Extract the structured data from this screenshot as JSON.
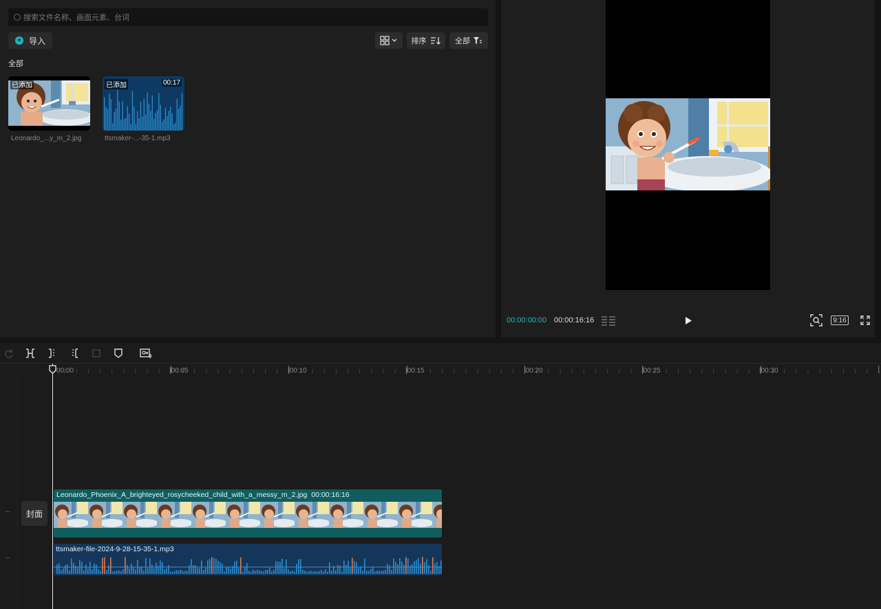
{
  "media": {
    "search_placeholder": "搜索文件名称、画面元素、台词",
    "import_label": "导入",
    "sort_label": "排序",
    "filter_label": "全部",
    "section_label": "全部",
    "items": [
      {
        "name": "Leonardo_...y_m_2.jpg",
        "badge": "已添加",
        "duration": ""
      },
      {
        "name": "ttsmaker-...-35-1.mp3",
        "badge": "已添加",
        "duration": "00:17"
      }
    ]
  },
  "preview": {
    "current_time": "00:00:00:00",
    "total_time": "00:00:16:16",
    "ratio_label": "9:16"
  },
  "timeline": {
    "ruler_labels": [
      "00:00",
      "|00:05",
      "|00:10",
      "|00:15",
      "|00:20",
      "|00:25",
      "|00:30"
    ],
    "cover_label": "封面",
    "video_clip": {
      "name": "Leonardo_Phoenix_A_brighteyed_rosycheeked_child_with_a_messy_m_2.jpg",
      "duration": "00:00:16:16"
    },
    "audio_clip": {
      "name": "ttsmaker-file-2024-9-28-15-35-1.mp3"
    },
    "more_label": "···"
  },
  "colors": {
    "accent": "#1fb7c5",
    "video_clip": "#0f5d5f",
    "audio_clip": "#14365a",
    "waveform": "#2a8fd0"
  }
}
